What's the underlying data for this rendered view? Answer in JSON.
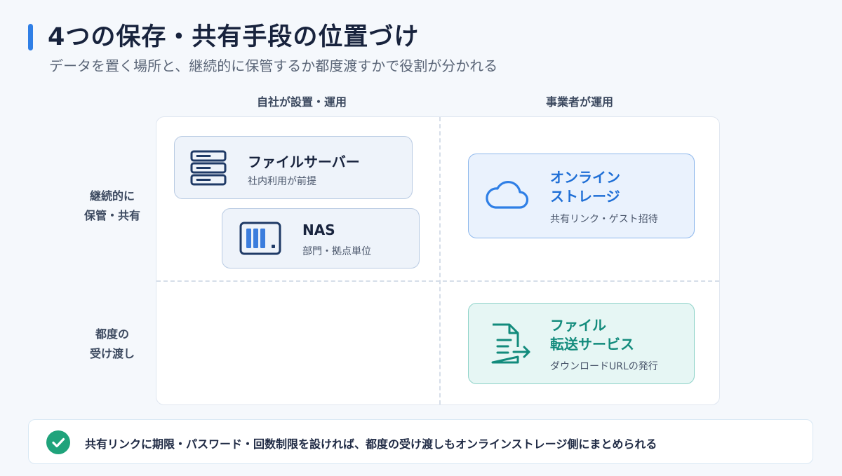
{
  "header": {
    "title": "4つの保存・共有手段の位置づけ",
    "subtitle": "データを置く場所と、継続的に保管するか都度渡すかで役割が分かれる"
  },
  "columns": {
    "left": "自社が設置・運用",
    "right": "事業者が運用"
  },
  "rows": {
    "top_line1": "継続的に",
    "top_line2": "保管・共有",
    "bottom_line1": "都度の",
    "bottom_line2": "受け渡し"
  },
  "cards": {
    "file_server": {
      "title": "ファイルサーバー",
      "sub": "社内利用が前提",
      "icon": "server-icon"
    },
    "nas": {
      "title": "NAS",
      "sub": "部門・拠点単位",
      "icon": "nas-icon"
    },
    "online_storage": {
      "title_line1": "オンライン",
      "title_line2": "ストレージ",
      "sub": "共有リンク・ゲスト招待",
      "icon": "cloud-icon"
    },
    "file_transfer": {
      "title_line1": "ファイル",
      "title_line2": "転送サービス",
      "sub": "ダウンロードURLの発行",
      "icon": "file-send-icon"
    }
  },
  "note": {
    "text": "共有リンクに期限・パスワード・回数制限を設ければ、都度の受け渡しもオンラインストレージ側にまとめられる",
    "icon": "check-icon"
  },
  "colors": {
    "accent": "#2f7fe6",
    "blue": "#1f6fd6",
    "teal": "#128b7c",
    "check": "#1fa37b"
  }
}
